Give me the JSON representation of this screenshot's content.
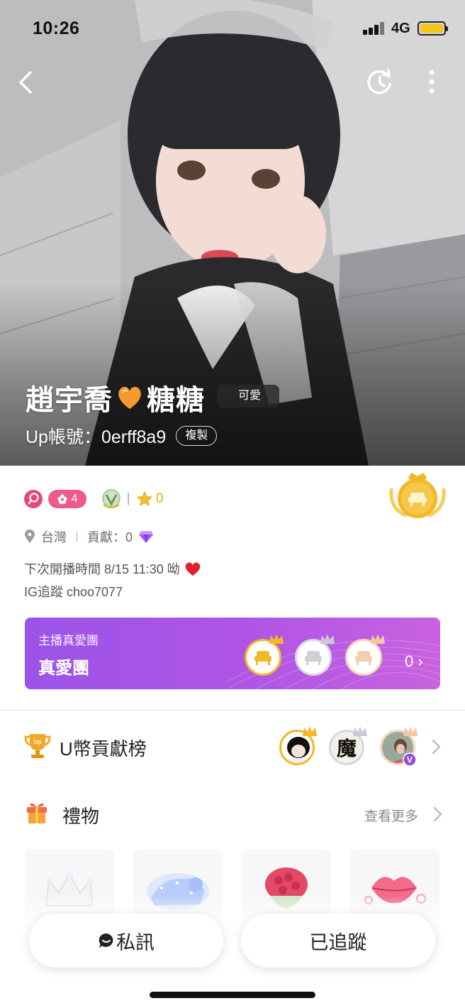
{
  "status_bar": {
    "time": "10:26",
    "network": "4G"
  },
  "profile": {
    "name_part1": "趙宇喬",
    "name_part2": "糖糖",
    "tag": "可愛",
    "id_label": "Up帳號：0erff8a9",
    "copy_label": "複製"
  },
  "badges": {
    "level": "4",
    "stars": "0"
  },
  "location": {
    "region": "台灣",
    "contribution": "貢獻：0"
  },
  "bio": {
    "line1": "下次開播時間 8/15 11:30 呦",
    "line2": "IG追蹤 choo7077"
  },
  "fan_club": {
    "label": "主播真愛團",
    "title": "真愛團",
    "count": "0 ›"
  },
  "ranking": {
    "title": "U幣貢獻榜",
    "avatar_badge": "V",
    "avatar2_text": "魔"
  },
  "gifts": {
    "title": "禮物",
    "more_label": "查看更多"
  },
  "actions": {
    "message_label": "私訊",
    "follow_label": "已追蹤"
  },
  "colors": {
    "accent_pink": "#e8457c",
    "fanclub_start": "#9b54e8",
    "fanclub_end": "#c962e0",
    "gold": "#f2b825",
    "star_yellow": "#e8b100"
  },
  "icons": [
    "back-icon",
    "share-icon",
    "more-icon",
    "orange-heart-icon",
    "search-badge-icon",
    "flower-icon",
    "emblem-icon",
    "star-icon",
    "crown-medal-icon",
    "location-pin-icon",
    "diamond-icon",
    "red-heart-icon",
    "seat-icon",
    "crown-icon",
    "trophy-icon",
    "chevron-right-icon",
    "gift-icon",
    "message-bubble-icon"
  ]
}
